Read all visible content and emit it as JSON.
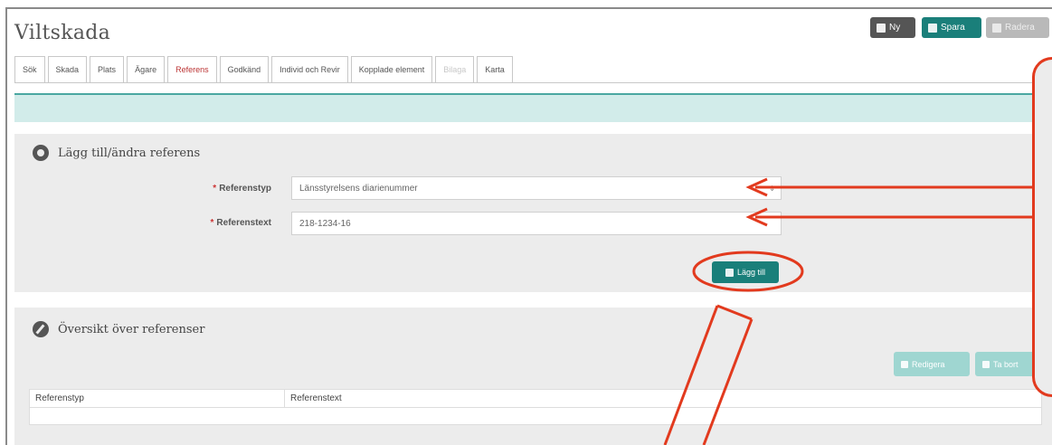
{
  "page": {
    "title": "Viltskada"
  },
  "toolbar": {
    "new_label": "Ny",
    "save_label": "Spara",
    "delete_label": "Radera"
  },
  "tabs": [
    {
      "label": "Sök",
      "state": "normal"
    },
    {
      "label": "Skada",
      "state": "normal"
    },
    {
      "label": "Plats",
      "state": "normal"
    },
    {
      "label": "Ägare",
      "state": "normal"
    },
    {
      "label": "Referens",
      "state": "active"
    },
    {
      "label": "Godkänd",
      "state": "normal"
    },
    {
      "label": "Individ och Revir",
      "state": "normal"
    },
    {
      "label": "Kopplade element",
      "state": "normal"
    },
    {
      "label": "Bilaga",
      "state": "disabled"
    },
    {
      "label": "Karta",
      "state": "normal"
    }
  ],
  "form_panel": {
    "title": "Lägg till/ändra referens",
    "reference_type_label": "Referenstyp",
    "reference_type_value": "Länsstyrelsens diarienummer",
    "reference_text_label": "Referenstext",
    "reference_text_value": "218-1234-16",
    "add_button_label": "Lägg till"
  },
  "overview_panel": {
    "title": "Översikt över referenser",
    "edit_button_label": "Redigera",
    "remove_button_label": "Ta bort",
    "columns": [
      "Referenstyp",
      "Referenstext"
    ]
  },
  "colors": {
    "accent": "#1a7f7a",
    "annotation": "#e23a1e",
    "info_bar": "#d2ecea"
  },
  "icons": [
    "new-icon",
    "save-icon",
    "delete-icon",
    "gear-icon",
    "pencil-icon",
    "add-icon",
    "edit-icon",
    "remove-icon"
  ]
}
